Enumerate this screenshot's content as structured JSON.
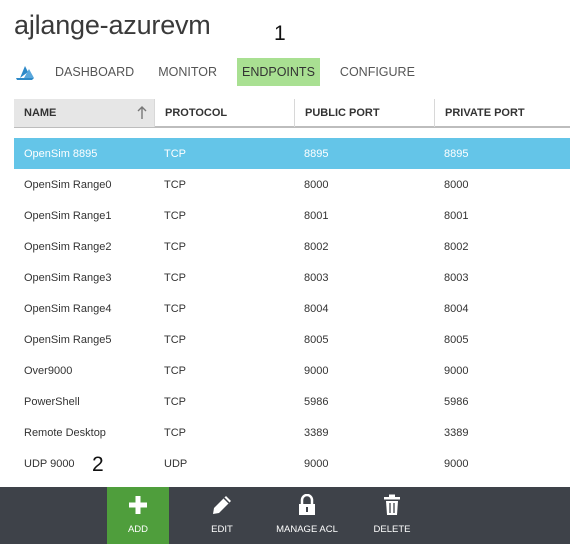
{
  "header": {
    "title": "ajlange-azurevm"
  },
  "annotations": {
    "one": "1",
    "two": "2"
  },
  "tabs": [
    {
      "label": "DASHBOARD",
      "active": false
    },
    {
      "label": "MONITOR",
      "active": false
    },
    {
      "label": "ENDPOINTS",
      "active": true
    },
    {
      "label": "CONFIGURE",
      "active": false
    }
  ],
  "table": {
    "columns": [
      "NAME",
      "PROTOCOL",
      "PUBLIC PORT",
      "PRIVATE PORT"
    ],
    "rows": [
      {
        "name": "OpenSim 8895",
        "protocol": "TCP",
        "public_port": "8895",
        "private_port": "8895",
        "selected": true
      },
      {
        "name": "OpenSim Range0",
        "protocol": "TCP",
        "public_port": "8000",
        "private_port": "8000"
      },
      {
        "name": "OpenSim Range1",
        "protocol": "TCP",
        "public_port": "8001",
        "private_port": "8001"
      },
      {
        "name": "OpenSim Range2",
        "protocol": "TCP",
        "public_port": "8002",
        "private_port": "8002"
      },
      {
        "name": "OpenSim Range3",
        "protocol": "TCP",
        "public_port": "8003",
        "private_port": "8003"
      },
      {
        "name": "OpenSim Range4",
        "protocol": "TCP",
        "public_port": "8004",
        "private_port": "8004"
      },
      {
        "name": "OpenSim Range5",
        "protocol": "TCP",
        "public_port": "8005",
        "private_port": "8005"
      },
      {
        "name": "Over9000",
        "protocol": "TCP",
        "public_port": "9000",
        "private_port": "9000"
      },
      {
        "name": "PowerShell",
        "protocol": "TCP",
        "public_port": "5986",
        "private_port": "5986"
      },
      {
        "name": "Remote Desktop",
        "protocol": "TCP",
        "public_port": "3389",
        "private_port": "3389"
      },
      {
        "name": "UDP 9000",
        "protocol": "UDP",
        "public_port": "9000",
        "private_port": "9000"
      }
    ]
  },
  "commands": {
    "add": "ADD",
    "edit": "EDIT",
    "manage_acl": "MANAGE ACL",
    "delete": "DELETE"
  },
  "colors": {
    "active_tab": "#a9e092",
    "selected_row": "#64c5e8",
    "command_bar": "#3e4249",
    "add_button": "#4f9e3c",
    "azure_icon": "#2d89c8"
  },
  "icons": {
    "azure": "azure-cloud-icon",
    "sort": "sort-arrow-up-icon",
    "add": "plus-icon",
    "edit": "pencil-icon",
    "manage_acl": "lock-icon",
    "delete": "trash-icon"
  }
}
